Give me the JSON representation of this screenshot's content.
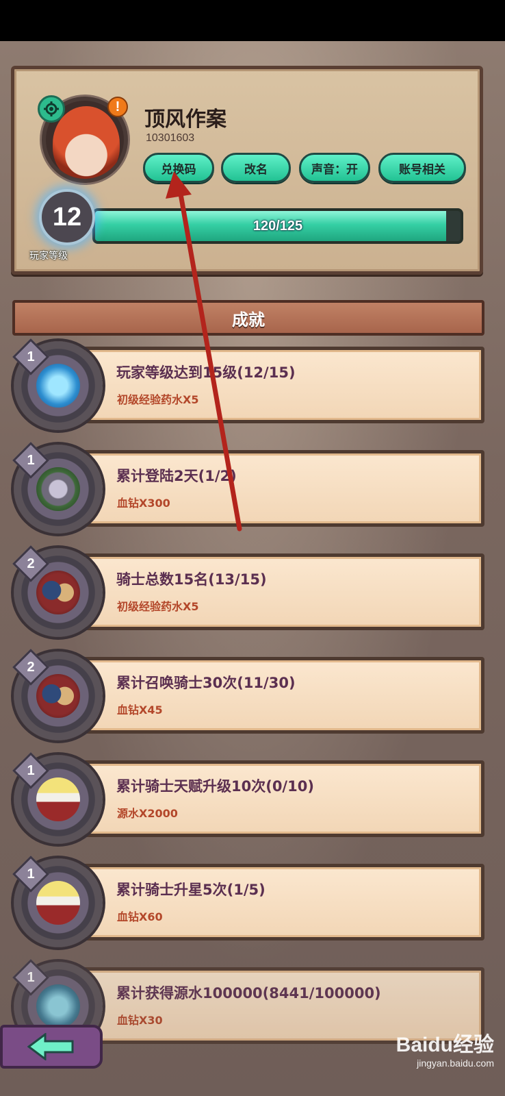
{
  "profile": {
    "name": "顶风作案",
    "id": "10301603",
    "level": "12",
    "level_caption": "玩家等级",
    "xp_text": "120/125",
    "xp_fraction": 0.96,
    "buttons": {
      "redeem": "兑换码",
      "rename": "改名",
      "sound": "声音：开",
      "account": "账号相关"
    },
    "alert_glyph": "!"
  },
  "section": {
    "title": "成就"
  },
  "achievements": [
    {
      "tier": "1",
      "title": "玩家等级达到15级(12/15)",
      "reward": "初级经验药水X5",
      "icon": "blue-flame-orb-icon"
    },
    {
      "tier": "1",
      "title": "累计登陆2天(1/2)",
      "reward": "血钻X300",
      "icon": "gear-crown-icon"
    },
    {
      "tier": "2",
      "title": "骑士总数15名(13/15)",
      "reward": "初级经验药水X5",
      "icon": "knight-group-icon"
    },
    {
      "tier": "2",
      "title": "累计召唤骑士30次(11/30)",
      "reward": "血钻X45",
      "icon": "knight-group-icon"
    },
    {
      "tier": "1",
      "title": "累计骑士天赋升级10次(0/10)",
      "reward": "源水X2000",
      "icon": "knight-hat-icon"
    },
    {
      "tier": "1",
      "title": "累计骑士升星5次(1/5)",
      "reward": "血钻X60",
      "icon": "knight-hat-icon"
    },
    {
      "tier": "1",
      "title": "累计获得源水100000(8441/100000)",
      "reward": "血钻X30",
      "icon": "water-orb-icon"
    }
  ],
  "watermark": {
    "logo": "Baidu经验",
    "url": "jingyan.baidu.com"
  },
  "colors": {
    "accent_green": "#2dbb8d",
    "title_purple": "#5b2f50",
    "reward_red": "#b3472a",
    "annotation_red": "#b3241c"
  }
}
